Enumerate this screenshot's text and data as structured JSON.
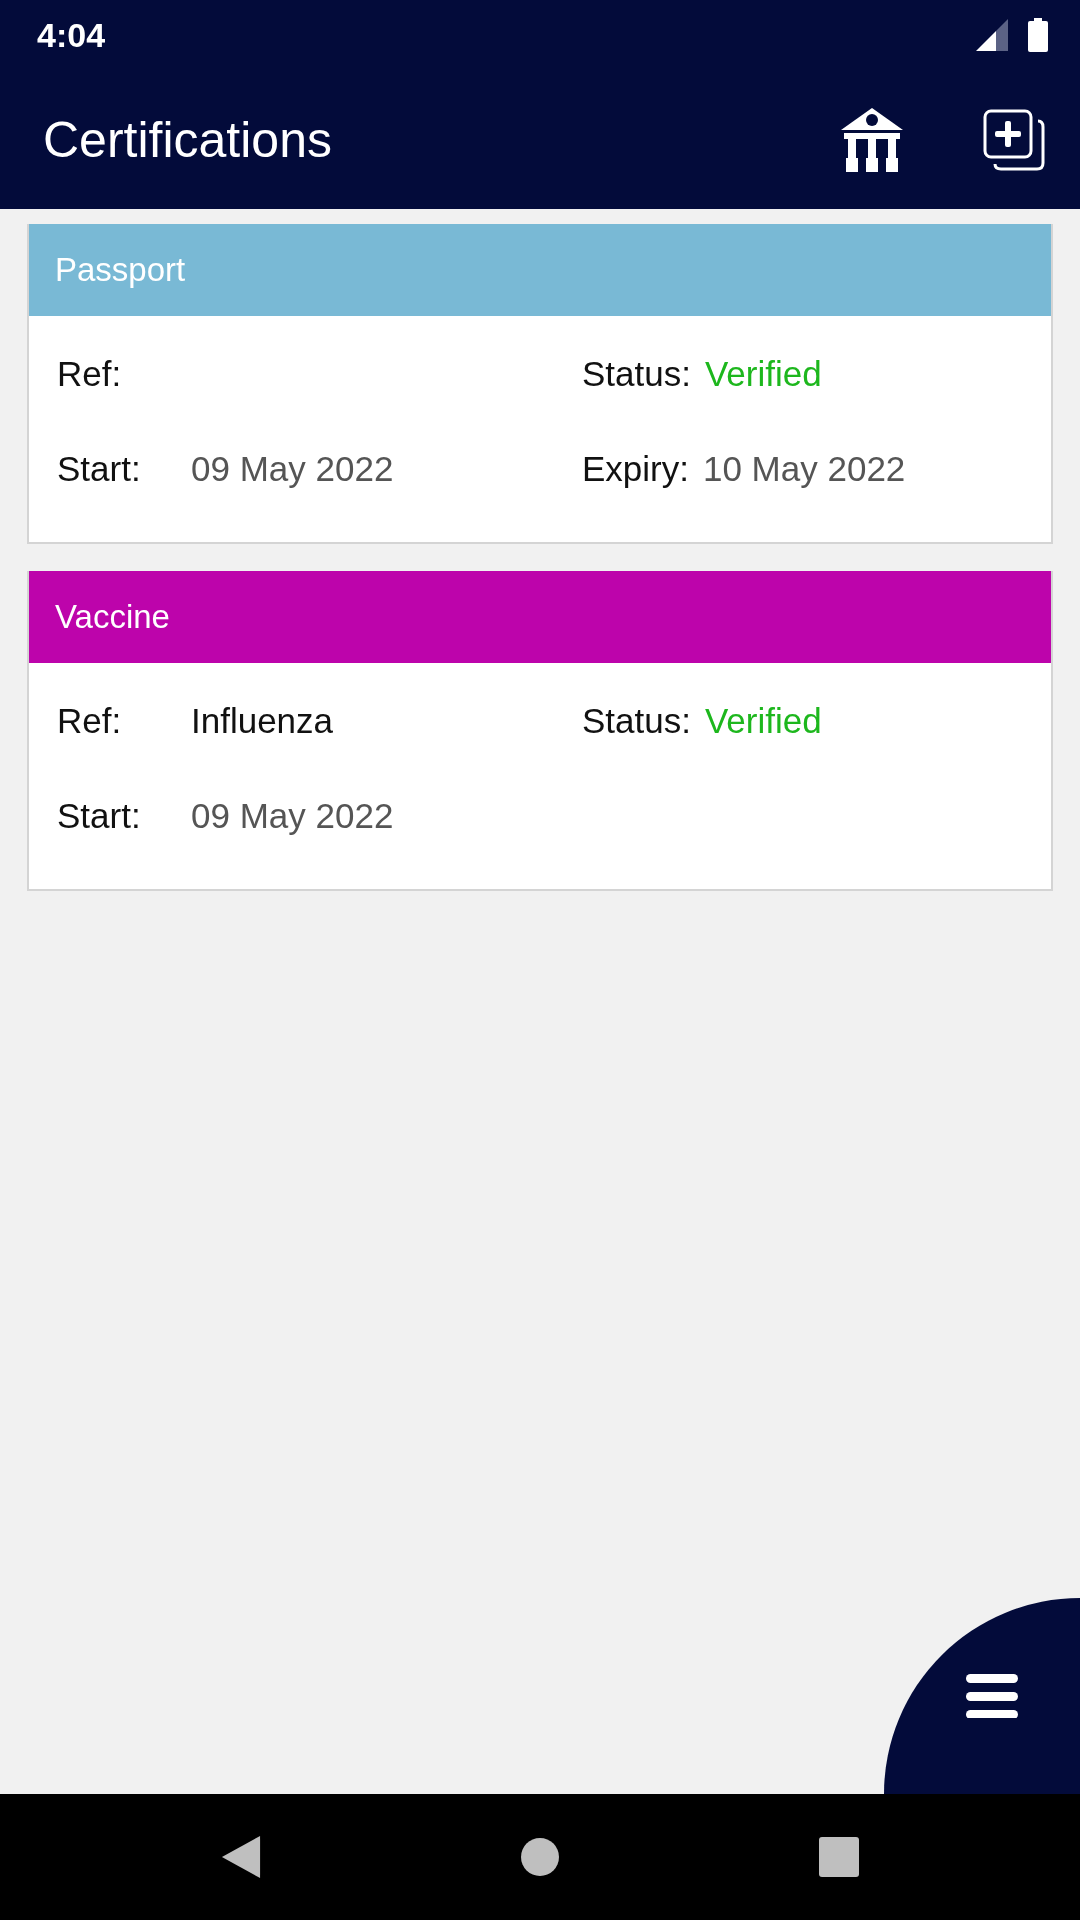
{
  "status_bar": {
    "time": "4:04"
  },
  "app_bar": {
    "title": "Certifications"
  },
  "certifications": [
    {
      "title": "Passport",
      "color": "#79b9d5",
      "fields": [
        {
          "label": "Ref:"
        },
        {
          "label": "Status:",
          "value": "Verified",
          "kind": "status"
        },
        {
          "label": "Start:",
          "value": "09 May 2022",
          "kind": "date"
        },
        {
          "label": "Expiry:",
          "value": "10 May 2022",
          "kind": "date"
        }
      ]
    },
    {
      "title": "Vaccine",
      "color": "#bd04ab",
      "fields": [
        {
          "label": "Ref:",
          "value": "Influenza",
          "kind": "text"
        },
        {
          "label": "Status:",
          "value": "Verified",
          "kind": "status"
        },
        {
          "label": "Start:",
          "value": "09 May 2022",
          "kind": "date"
        }
      ]
    }
  ]
}
